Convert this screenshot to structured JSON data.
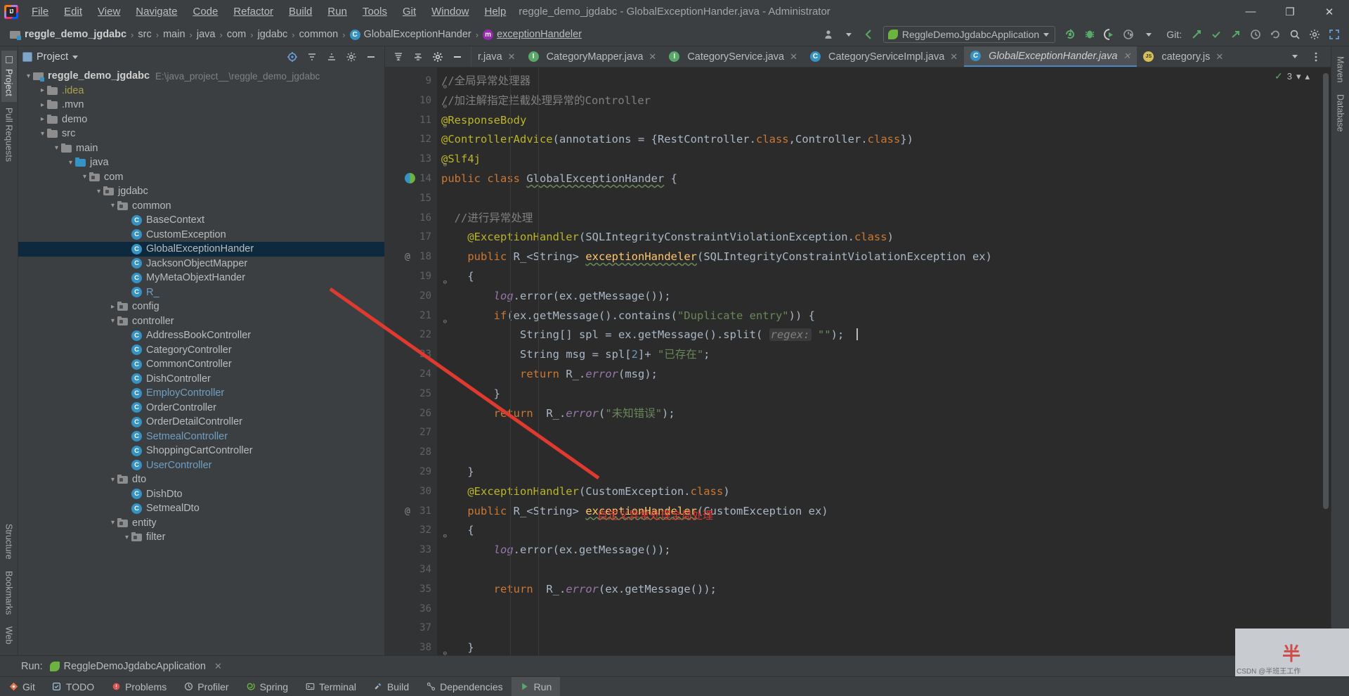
{
  "window": {
    "title": "reggle_demo_jgdabc - GlobalExceptionHander.java - Administrator",
    "minimize": "—",
    "maximize": "❐",
    "close": "✕"
  },
  "menu": [
    {
      "label": "File"
    },
    {
      "label": "Edit"
    },
    {
      "label": "View"
    },
    {
      "label": "Navigate"
    },
    {
      "label": "Code"
    },
    {
      "label": "Refactor"
    },
    {
      "label": "Build"
    },
    {
      "label": "Run"
    },
    {
      "label": "Tools"
    },
    {
      "label": "Git"
    },
    {
      "label": "Window"
    },
    {
      "label": "Help"
    }
  ],
  "navbar": {
    "crumbs": [
      {
        "label": "reggle_demo_jgdabc",
        "icon": "module-icon",
        "bold": true
      },
      {
        "label": "src",
        "icon": "folder-icon"
      },
      {
        "label": "main",
        "icon": "folder-icon"
      },
      {
        "label": "java",
        "icon": "folder-icon"
      },
      {
        "label": "com",
        "icon": "package-icon"
      },
      {
        "label": "jgdabc",
        "icon": "package-icon"
      },
      {
        "label": "common",
        "icon": "package-icon"
      },
      {
        "label": "GlobalExceptionHander",
        "icon": "class-icon"
      },
      {
        "label": "exceptionHandeler",
        "icon": "method-icon"
      }
    ],
    "separator": "›",
    "run_configuration": "ReggleDemoJgdabcApplication",
    "git_label": "Git:",
    "icons": [
      "avatar-icon",
      "back-icon",
      "rerun-icon",
      "debug-icon",
      "run-with-coverage-icon",
      "profiler-icon",
      "git-update-icon",
      "git-commit-icon",
      "git-push-icon",
      "git-history-icon",
      "git-rollback-icon",
      "search-icon",
      "settings-icon",
      "fullscreen-icon"
    ]
  },
  "left_rail": [
    {
      "label": "Project",
      "active": true
    },
    {
      "label": "Pull Requests",
      "active": false
    },
    {
      "label": "Structure",
      "active": false
    },
    {
      "label": "Bookmarks",
      "active": false
    },
    {
      "label": "Web",
      "active": false
    }
  ],
  "right_rail": [
    {
      "label": "Maven"
    },
    {
      "label": "Database"
    }
  ],
  "project_panel": {
    "title": "Project",
    "tree": [
      {
        "depth": 0,
        "arrow": "∨",
        "icon": "module-icon",
        "label": "reggle_demo_jgdabc",
        "bold": true,
        "path": "E:\\java_project__\\reggle_demo_jgdabc"
      },
      {
        "depth": 1,
        "arrow": "›",
        "icon": "folder-icon",
        "label": ".idea",
        "color": "yellow"
      },
      {
        "depth": 1,
        "arrow": "›",
        "icon": "folder-icon",
        "label": ".mvn"
      },
      {
        "depth": 1,
        "arrow": "›",
        "icon": "folder-icon",
        "label": "demo"
      },
      {
        "depth": 1,
        "arrow": "∨",
        "icon": "folder-icon",
        "label": "src"
      },
      {
        "depth": 2,
        "arrow": "∨",
        "icon": "folder-icon",
        "label": "main"
      },
      {
        "depth": 3,
        "arrow": "∨",
        "icon": "source-folder-icon",
        "label": "java"
      },
      {
        "depth": 4,
        "arrow": "∨",
        "icon": "package-icon",
        "label": "com"
      },
      {
        "depth": 5,
        "arrow": "∨",
        "icon": "package-icon",
        "label": "jgdabc"
      },
      {
        "depth": 6,
        "arrow": "∨",
        "icon": "package-icon",
        "label": "common"
      },
      {
        "depth": 7,
        "arrow": "",
        "icon": "class-icon",
        "label": "BaseContext"
      },
      {
        "depth": 7,
        "arrow": "",
        "icon": "class-icon",
        "label": "CustomException"
      },
      {
        "depth": 7,
        "arrow": "",
        "icon": "class-icon",
        "label": "GlobalExceptionHander",
        "selected": true
      },
      {
        "depth": 7,
        "arrow": "",
        "icon": "class-icon",
        "label": "JacksonObjectMapper"
      },
      {
        "depth": 7,
        "arrow": "",
        "icon": "class-icon",
        "label": "MyMetaObjextHander"
      },
      {
        "depth": 7,
        "arrow": "",
        "icon": "class-icon",
        "label": "R_",
        "color": "blue"
      },
      {
        "depth": 6,
        "arrow": "›",
        "icon": "package-icon",
        "label": "config"
      },
      {
        "depth": 6,
        "arrow": "∨",
        "icon": "package-icon",
        "label": "controller"
      },
      {
        "depth": 7,
        "arrow": "",
        "icon": "class-icon",
        "label": "AddressBookController"
      },
      {
        "depth": 7,
        "arrow": "",
        "icon": "class-icon",
        "label": "CategoryController"
      },
      {
        "depth": 7,
        "arrow": "",
        "icon": "class-icon",
        "label": "CommonController"
      },
      {
        "depth": 7,
        "arrow": "",
        "icon": "class-icon",
        "label": "DishController"
      },
      {
        "depth": 7,
        "arrow": "",
        "icon": "class-icon",
        "label": "EmployController",
        "color": "blue"
      },
      {
        "depth": 7,
        "arrow": "",
        "icon": "class-icon",
        "label": "OrderController"
      },
      {
        "depth": 7,
        "arrow": "",
        "icon": "class-icon",
        "label": "OrderDetailController"
      },
      {
        "depth": 7,
        "arrow": "",
        "icon": "class-icon",
        "label": "SetmealController",
        "color": "blue"
      },
      {
        "depth": 7,
        "arrow": "",
        "icon": "class-icon",
        "label": "ShoppingCartController"
      },
      {
        "depth": 7,
        "arrow": "",
        "icon": "class-icon",
        "label": "UserController",
        "color": "blue"
      },
      {
        "depth": 6,
        "arrow": "∨",
        "icon": "package-icon",
        "label": "dto"
      },
      {
        "depth": 7,
        "arrow": "",
        "icon": "class-icon",
        "label": "DishDto"
      },
      {
        "depth": 7,
        "arrow": "",
        "icon": "class-icon",
        "label": "SetmealDto"
      },
      {
        "depth": 6,
        "arrow": "∨",
        "icon": "package-icon",
        "label": "entity"
      },
      {
        "depth": 7,
        "arrow": "∨",
        "icon": "package-icon",
        "label": "filter"
      }
    ]
  },
  "editor": {
    "tabs": [
      {
        "label": "r.java",
        "icon": "class-icon",
        "truncated": true,
        "active": false
      },
      {
        "label": "CategoryMapper.java",
        "icon": "interface-icon",
        "active": false
      },
      {
        "label": "CategoryService.java",
        "icon": "interface-icon",
        "active": false
      },
      {
        "label": "CategoryServiceImpl.java",
        "icon": "class-icon",
        "active": false
      },
      {
        "label": "GlobalExceptionHander.java",
        "icon": "class-icon",
        "active": true
      },
      {
        "label": "category.js",
        "icon": "js-icon",
        "active": false
      }
    ],
    "inspection_count": "3",
    "lines": [
      {
        "n": "9",
        "fold": "⊖",
        "html": "<span class=\"cmt\">//全局异常处理器</span>"
      },
      {
        "n": "10",
        "fold": "⊖",
        "html": "<span class=\"cmt\">//加注解指定拦截处理异常的Controller</span>"
      },
      {
        "n": "11",
        "fold": "⊖",
        "html": "<span class=\"ann\">@ResponseBody</span>"
      },
      {
        "n": "12",
        "html": "<span class=\"ann\">@ControllerAdvice</span>(<span class=\"cls\">annotations</span> = {<span class=\"cls\">RestController</span>.<span class=\"kw\">class</span>,<span class=\"cls\">Controller</span>.<span class=\"kw\">class</span>})"
      },
      {
        "n": "13",
        "fold": "⊖",
        "html": "<span class=\"ann\">@Slf4j</span>"
      },
      {
        "n": "14",
        "bean": true,
        "html": "<span class=\"kw\">public class</span> <span class=\"cls underline-w\">GlobalExceptionHander</span> {"
      },
      {
        "n": "15",
        "html": ""
      },
      {
        "n": "16",
        "html": "  <span class=\"cmt\">//进行异常处理</span>"
      },
      {
        "n": "17",
        "html": "    <span class=\"ann\">@ExceptionHandler</span>(<span class=\"cls\">SQLIntegrityConstraintViolationException</span>.<span class=\"kw\">class</span>)"
      },
      {
        "n": "18",
        "at": "@",
        "html": "    <span class=\"kw\">public</span> <span class=\"cls\">R_&lt;String&gt;</span> <span class=\"meth underline-w\">exceptionHandeler</span>(<span class=\"cls\">SQLIntegrityConstraintViolationException</span> ex)"
      },
      {
        "n": "19",
        "fold": "⊖",
        "html": "    {"
      },
      {
        "n": "20",
        "html": "        <span class=\"fld2\">log</span>.error(ex.getMessage());"
      },
      {
        "n": "21",
        "fold": "⊖",
        "html": "        <span class=\"kw\">if</span>(ex.getMessage().contains(<span class=\"str\">\"Duplicate entry\"</span>)) {"
      },
      {
        "n": "22",
        "html": "            <span class=\"cls\">String</span>[] spl = ex.getMessage().split( <span class=\"hint\">regex:</span> <span class=\"str\">\"​\"</span>);"
      },
      {
        "n": "23",
        "html": "            <span class=\"cls\">String</span> msg = spl[<span class=\"num\">2</span>]+ <span class=\"str\">\"已存在\"</span>;"
      },
      {
        "n": "24",
        "html": "            <span class=\"kw\">return</span> <span class=\"cls\">R_</span>.<span class=\"fld2\">error</span>(msg);"
      },
      {
        "n": "25",
        "html": "        }"
      },
      {
        "n": "26",
        "html": "        <span class=\"kw\">return</span>  <span class=\"cls\">R_</span>.<span class=\"fld2\">error</span>(<span class=\"str\">\"未知错误\"</span>);"
      },
      {
        "n": "27",
        "html": ""
      },
      {
        "n": "28",
        "html": ""
      },
      {
        "n": "29",
        "html": "    }"
      },
      {
        "n": "30",
        "html": "    <span class=\"ann\">@ExceptionHandler</span>(<span class=\"cls\">CustomException</span>.<span class=\"kw\">class</span>)"
      },
      {
        "n": "31",
        "at": "@",
        "html": "    <span class=\"kw\">public</span> <span class=\"cls\">R_&lt;String&gt;</span> <span class=\"meth underline-w\">exceptionHandeler</span>(<span class=\"cls\">CustomException</span> ex)"
      },
      {
        "n": "32",
        "fold": "⊖",
        "html": "    {"
      },
      {
        "n": "33",
        "html": "        <span class=\"fld2\">log</span>.error(ex.getMessage());"
      },
      {
        "n": "34",
        "html": ""
      },
      {
        "n": "35",
        "html": "        <span class=\"kw\">return</span>  <span class=\"cls\">R_</span>.<span class=\"fld2\">error</span>(ex.getMessage());"
      },
      {
        "n": "36",
        "html": ""
      },
      {
        "n": "37",
        "html": ""
      },
      {
        "n": "38",
        "fold": "⊖",
        "html": "    }"
      }
    ],
    "annotation_note": "自定义异常处理全局处理"
  },
  "run_panel": {
    "run_label": "Run:",
    "configuration": "ReggleDemoJgdabcApplication",
    "close": "✕"
  },
  "status_bar": [
    {
      "label": "Git",
      "icon": "git-icon"
    },
    {
      "label": "TODO",
      "icon": "todo-icon"
    },
    {
      "label": "Problems",
      "icon": "problems-icon"
    },
    {
      "label": "Profiler",
      "icon": "profiler-icon"
    },
    {
      "label": "Spring",
      "icon": "spring-icon"
    },
    {
      "label": "Terminal",
      "icon": "terminal-icon"
    },
    {
      "label": "Build",
      "icon": "build-icon"
    },
    {
      "label": "Dependencies",
      "icon": "dependencies-icon"
    },
    {
      "label": "Run",
      "icon": "run-icon",
      "active": true
    }
  ],
  "watermark": {
    "text": "半",
    "tag": "CSDN @半班王工作"
  },
  "colors": {
    "accent": "#4a88c7",
    "selection": "#0d293e",
    "panel": "#3c3f41",
    "editor_bg": "#2b2b2b",
    "annotation_red": "#e03a30",
    "green": "#59a869"
  }
}
